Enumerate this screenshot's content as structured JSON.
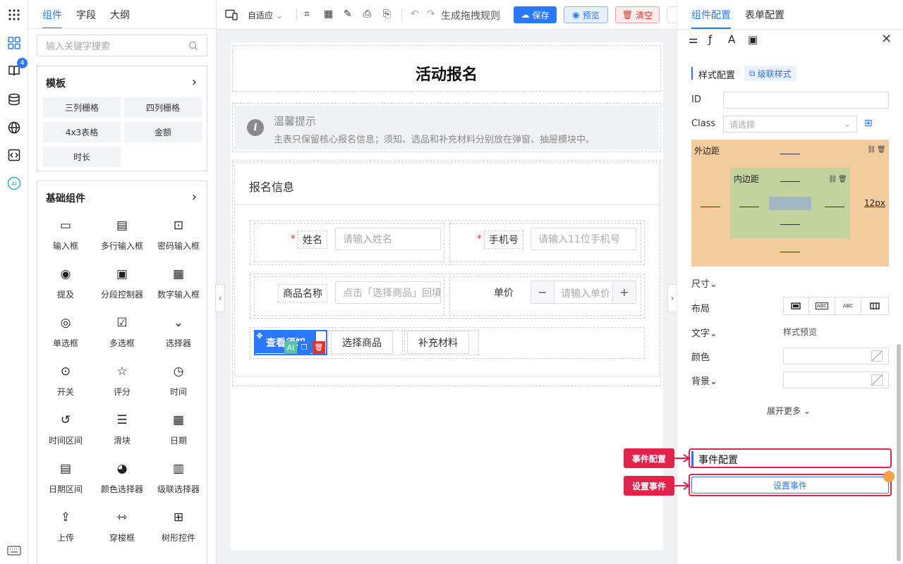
{
  "left_panel": {
    "tabs": [
      "组件",
      "字段",
      "大纲"
    ],
    "search_placeholder": "输入关键字搜索",
    "templates_title": "模板",
    "templates": [
      "三列栅格",
      "四列栅格",
      "4x3表格",
      "金额",
      "时长"
    ],
    "basic_title": "基础组件",
    "components": [
      "输入框",
      "多行输入框",
      "密码输入框",
      "提及",
      "分段控制器",
      "数字输入框",
      "单选框",
      "多选框",
      "选择器",
      "开关",
      "评分",
      "时间",
      "时间区间",
      "滑块",
      "日期",
      "日期区间",
      "颜色选择器",
      "级联选择器",
      "上传",
      "穿梭框",
      "树形控件"
    ]
  },
  "rail": {
    "badge_count": "4",
    "ai_label": "AI"
  },
  "toolbar": {
    "adapt": "自适应",
    "generate": "生成拖拽规则",
    "save": "保存",
    "preview": "预览",
    "clear": "清空"
  },
  "form": {
    "title": "活动报名",
    "alert_title": "温馨提示",
    "alert_text": "主表只保留核心报名信息；须知、选品和补充材料分别放在弹窗、抽屉模块中。",
    "card_title": "报名信息",
    "name_label": "姓名",
    "name_placeholder": "请输入姓名",
    "phone_label": "手机号",
    "phone_placeholder": "请输入11位手机号",
    "product_label": "商品名称",
    "product_placeholder": "点击「选择商品」回填",
    "price_label": "单价",
    "price_placeholder": "请输入单价",
    "btn_notice": "查看须知",
    "btn_select": "选择商品",
    "btn_material": "补充材料",
    "ai_tag": "AI"
  },
  "right_panel": {
    "tabs": [
      "组件配置",
      "表单配置"
    ],
    "style_config": "样式配置",
    "cascade_style": "级联样式",
    "id_label": "ID",
    "class_label": "Class",
    "class_placeholder": "请选择",
    "margin_label": "外边距",
    "padding_label": "内边距",
    "margin_right_value": "12px",
    "size_label": "尺寸",
    "layout_label": "布局",
    "layout_options": [
      "ABC",
      "ABC"
    ],
    "text_label": "文字",
    "style_preview": "样式预览",
    "color_label": "颜色",
    "bg_label": "背景",
    "expand_more": "展开更多",
    "event_config": "事件配置",
    "set_event": "设置事件"
  },
  "callouts": {
    "event_config": "事件配置",
    "set_event": "设置事件"
  },
  "colors": {
    "primary": "#2a78ff",
    "danger": "#e3224c",
    "margin": "#f3cc9e",
    "padding": "#c3d39e",
    "content": "#a1b8c4"
  }
}
